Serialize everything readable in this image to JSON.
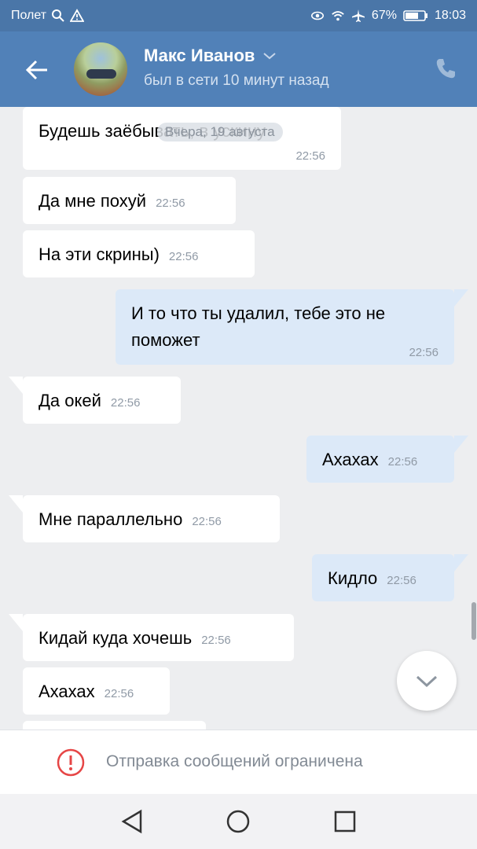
{
  "status_bar": {
    "carrier": "Полет",
    "battery": "67%",
    "time": "18:03"
  },
  "header": {
    "name": "Макс Иванов",
    "status": "был в сети 10 минут назад"
  },
  "date_separator": "Вчера, 19 августа",
  "messages": [
    {
      "dir": "in",
      "text": "Будешь заёбывать, в ускину",
      "time": "22:56"
    },
    {
      "dir": "in",
      "text": "Да мне похуй",
      "time": "22:56"
    },
    {
      "dir": "in",
      "text": "На эти скрины)",
      "time": "22:56"
    },
    {
      "dir": "out",
      "text": "И то что ты удалил, тебе это не поможет",
      "time": "22:56"
    },
    {
      "dir": "in",
      "text": "Да окей",
      "time": "22:56"
    },
    {
      "dir": "out",
      "text": "Ахахах",
      "time": "22:56"
    },
    {
      "dir": "in",
      "text": "Мне параллельно",
      "time": "22:56"
    },
    {
      "dir": "out",
      "text": "Кидло",
      "time": "22:56"
    },
    {
      "dir": "in",
      "text": "Кидай куда хочешь",
      "time": "22:56"
    },
    {
      "dir": "in",
      "text": "Ахахах",
      "time": "22:56"
    }
  ],
  "restriction": {
    "text": "Отправка сообщений ограничена"
  },
  "icons": {
    "back": "arrow-left-icon",
    "call": "phone-icon",
    "scroll_down": "chevron-down-icon",
    "warning": "exclamation-circle-icon"
  },
  "colors": {
    "header": "#5181b8",
    "incoming": "#ffffff",
    "outgoing": "#dce9f8",
    "warning": "#e64646"
  }
}
